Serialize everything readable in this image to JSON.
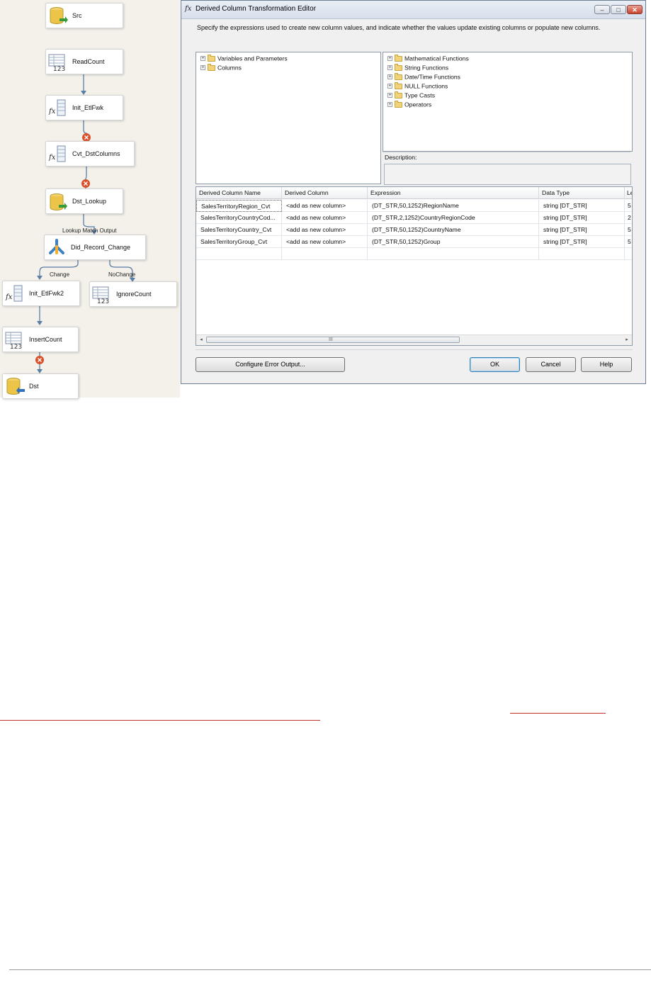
{
  "flow": {
    "nodes": [
      {
        "label": "Src",
        "icon": "database-source-icon"
      },
      {
        "label": "ReadCount",
        "icon": "row-count-icon"
      },
      {
        "label": "Init_EtlFwk",
        "icon": "derived-column-icon"
      },
      {
        "label": "Cvt_DstColumns",
        "icon": "derived-column-icon"
      },
      {
        "label": "Dst_Lookup",
        "icon": "lookup-icon"
      },
      {
        "label": "Did_Record_Change",
        "icon": "conditional-split-icon"
      },
      {
        "label": "Init_EtlFwk2",
        "icon": "derived-column-icon"
      },
      {
        "label": "IgnoreCount",
        "icon": "row-count-icon"
      },
      {
        "label": "InsertCount",
        "icon": "row-count-icon"
      },
      {
        "label": "Dst",
        "icon": "database-destination-icon"
      }
    ],
    "path_labels": {
      "lookup_match": "Lookup Match Output",
      "change": "Change",
      "nochange": "NoChange"
    }
  },
  "dialog": {
    "title": "Derived Column Transformation Editor",
    "title_icon": "fx",
    "window_buttons": {
      "minimize": "‒",
      "maximize": "□",
      "close": "✕"
    },
    "instructions": "Specify the expressions used to create new column values, and indicate whether the values update existing columns or populate new columns.",
    "left_tree": [
      "Variables and Parameters",
      "Columns"
    ],
    "right_tree": [
      "Mathematical Functions",
      "String Functions",
      "Date/Time Functions",
      "NULL Functions",
      "Type Casts",
      "Operators"
    ],
    "description_label": "Description:",
    "grid": {
      "columns": [
        "Derived Column Name",
        "Derived Column",
        "Expression",
        "Data Type",
        "Le"
      ],
      "rows": [
        [
          "SalesTerritoryRegion_Cvt",
          "<add as new column>",
          "(DT_STR,50,1252)RegionName",
          "string [DT_STR]",
          "5"
        ],
        [
          "SalesTerritoryCountryCod...",
          "<add as new column>",
          "(DT_STR,2,1252)CountryRegionCode",
          "string [DT_STR]",
          "2"
        ],
        [
          "SalesTerritoryCountry_Cvt",
          "<add as new column>",
          "(DT_STR,50,1252)CountryName",
          "string [DT_STR]",
          "5"
        ],
        [
          "SalesTerritoryGroup_Cvt",
          "<add as new column>",
          "(DT_STR,50,1252)Group",
          "string [DT_STR]",
          "5"
        ]
      ],
      "scroll_left": "◂",
      "scroll_right": "▸",
      "scroll_grip": "III"
    },
    "buttons": {
      "configure": "Configure Error Output...",
      "ok": "OK",
      "cancel": "Cancel",
      "help": "Help"
    }
  }
}
